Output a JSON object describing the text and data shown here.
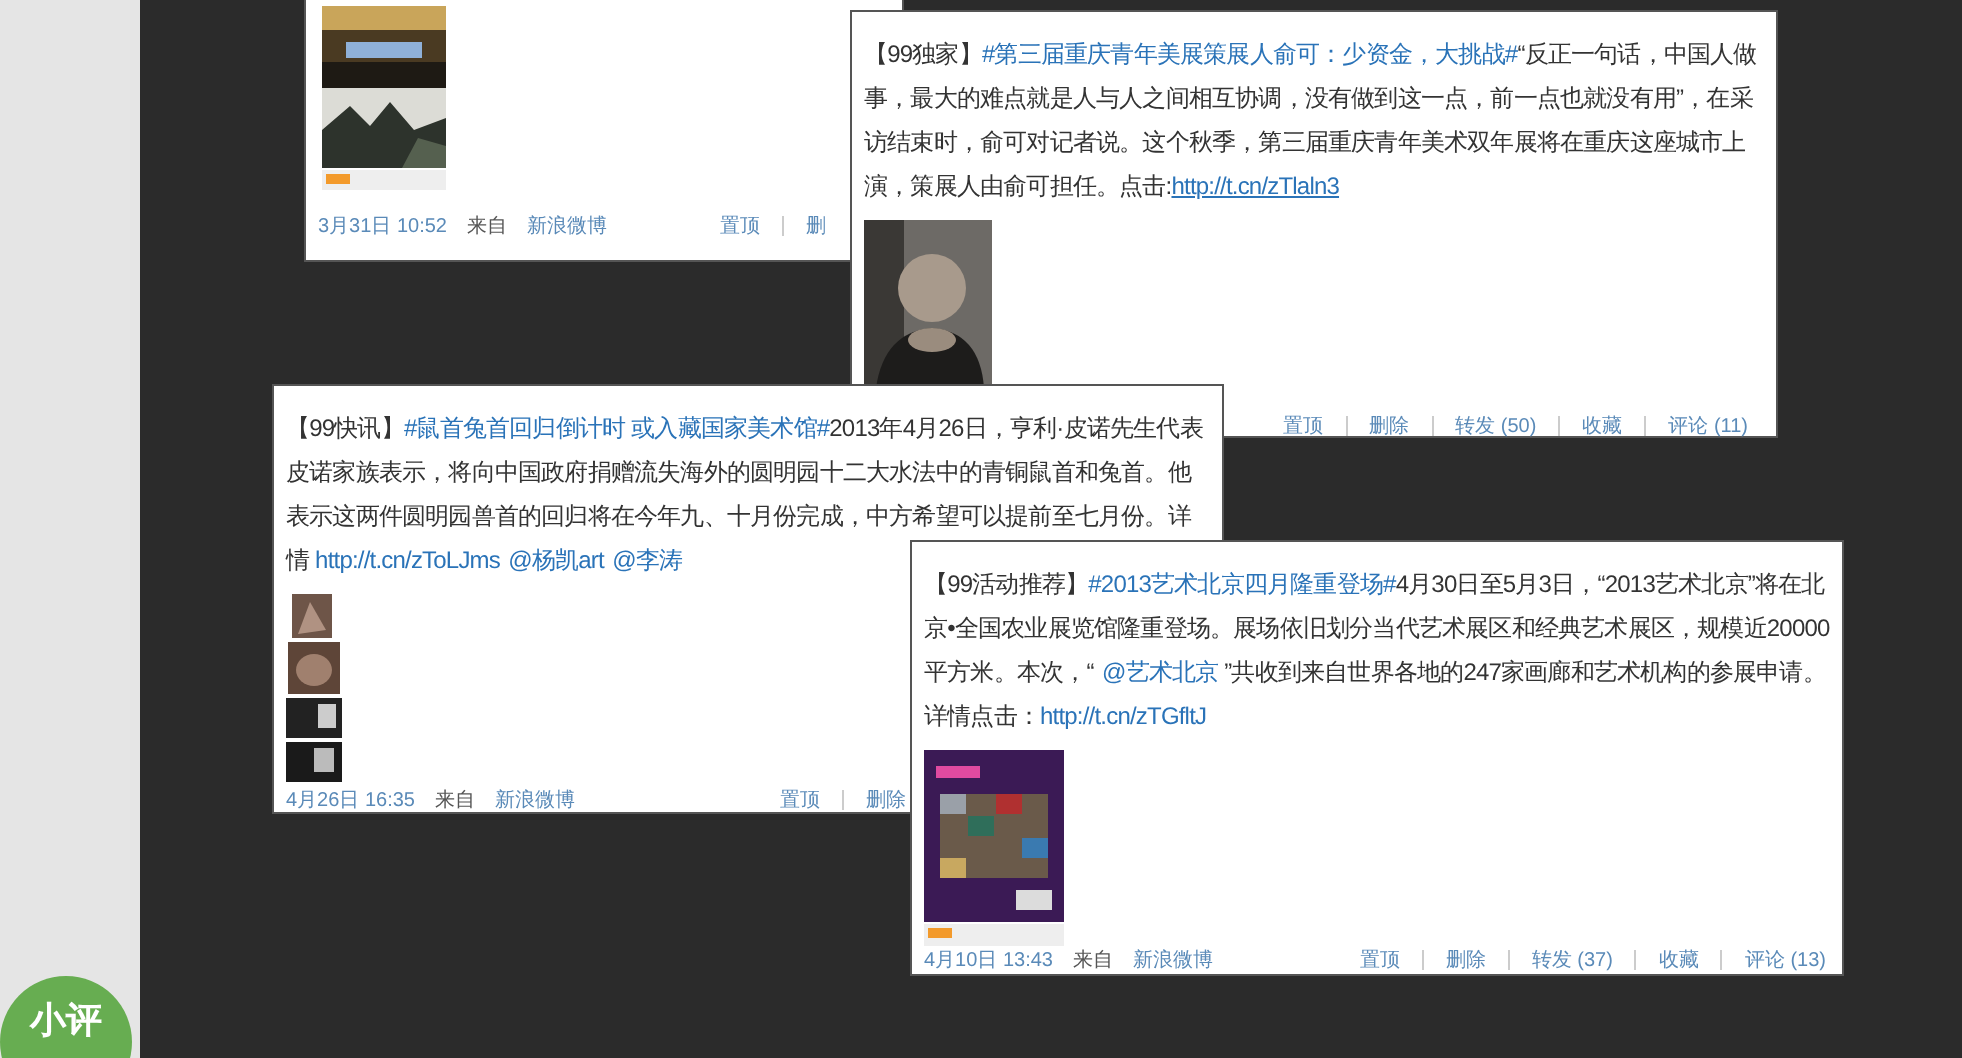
{
  "sidebar": {
    "badge": "小评"
  },
  "posts": [
    {
      "images": [
        {
          "kind": "picture"
        }
      ],
      "footer": {
        "date": "3月31日 10:52",
        "source_label": "来自",
        "source": "新浪微博",
        "actions": [
          "置顶",
          "删"
        ]
      }
    },
    {
      "segments": [
        {
          "kind": "text",
          "text": "【99独家】"
        },
        {
          "kind": "tag",
          "text": "#第三届重庆青年美展策展人俞可：少资金，大挑战#"
        },
        {
          "kind": "text",
          "text": "“反正一句话，中国人做事，最大的难点就是人与人之间相互协调，没有做到这一点，前一点也就没有用”，在采访结束时，俞可对记者说。这个秋季，第三届重庆青年美术双年展将在重庆这座城市上演，策展人由俞可担任。点击:"
        },
        {
          "kind": "link",
          "text": "http://t.cn/zTlaln3"
        }
      ],
      "images": [
        {
          "kind": "picture"
        }
      ],
      "footer": {
        "actions": [
          "置顶",
          "删除",
          "转发 (50)",
          "收藏",
          "评论 (11)"
        ]
      }
    },
    {
      "segments": [
        {
          "kind": "text",
          "text": "【99快讯】"
        },
        {
          "kind": "tag",
          "text": "#鼠首兔首回归倒计时 或入藏国家美术馆#"
        },
        {
          "kind": "text",
          "text": "2013年4月26日，亨利·皮诺先生代表皮诺家族表示，将向中国政府捐赠流失海外的圆明园十二大水法中的青铜鼠首和兔首。他表示这两件圆明园兽首的回归将在今年九、十月份完成，中方希望可以提前至七月份。详情 "
        },
        {
          "kind": "link",
          "text": "http://t.cn/zToLJms"
        },
        {
          "kind": "mention",
          "text": "@杨凯art"
        },
        {
          "kind": "mention",
          "text": "@李涛"
        }
      ],
      "images": [
        {
          "kind": "picture"
        }
      ],
      "footer": {
        "date": "4月26日 16:35",
        "source_label": "来自",
        "source": "新浪微博",
        "actions": [
          "置顶",
          "删除"
        ]
      }
    },
    {
      "segments": [
        {
          "kind": "text",
          "text": "【99活动推荐】"
        },
        {
          "kind": "tag",
          "text": "#2013艺术北京四月隆重登场#"
        },
        {
          "kind": "text",
          "text": "4月30日至5月3日，“2013艺术北京”将在北京•全国农业展览馆隆重登场。展场依旧划分当代艺术展区和经典艺术展区，规模近20000平方米。本次，“"
        },
        {
          "kind": "mention",
          "text": "@艺术北京"
        },
        {
          "kind": "text",
          "text": " ”共收到来自世界各地的247家画廊和艺术机构的参展申请。详情点击："
        },
        {
          "kind": "link",
          "text": "http://t.cn/zTGfltJ"
        }
      ],
      "images": [
        {
          "kind": "picture"
        }
      ],
      "footer": {
        "date": "4月10日 13:43",
        "source_label": "来自",
        "source": "新浪微博",
        "actions": [
          "置顶",
          "删除",
          "转发 (37)",
          "收藏",
          "评论 (13)"
        ]
      }
    }
  ]
}
